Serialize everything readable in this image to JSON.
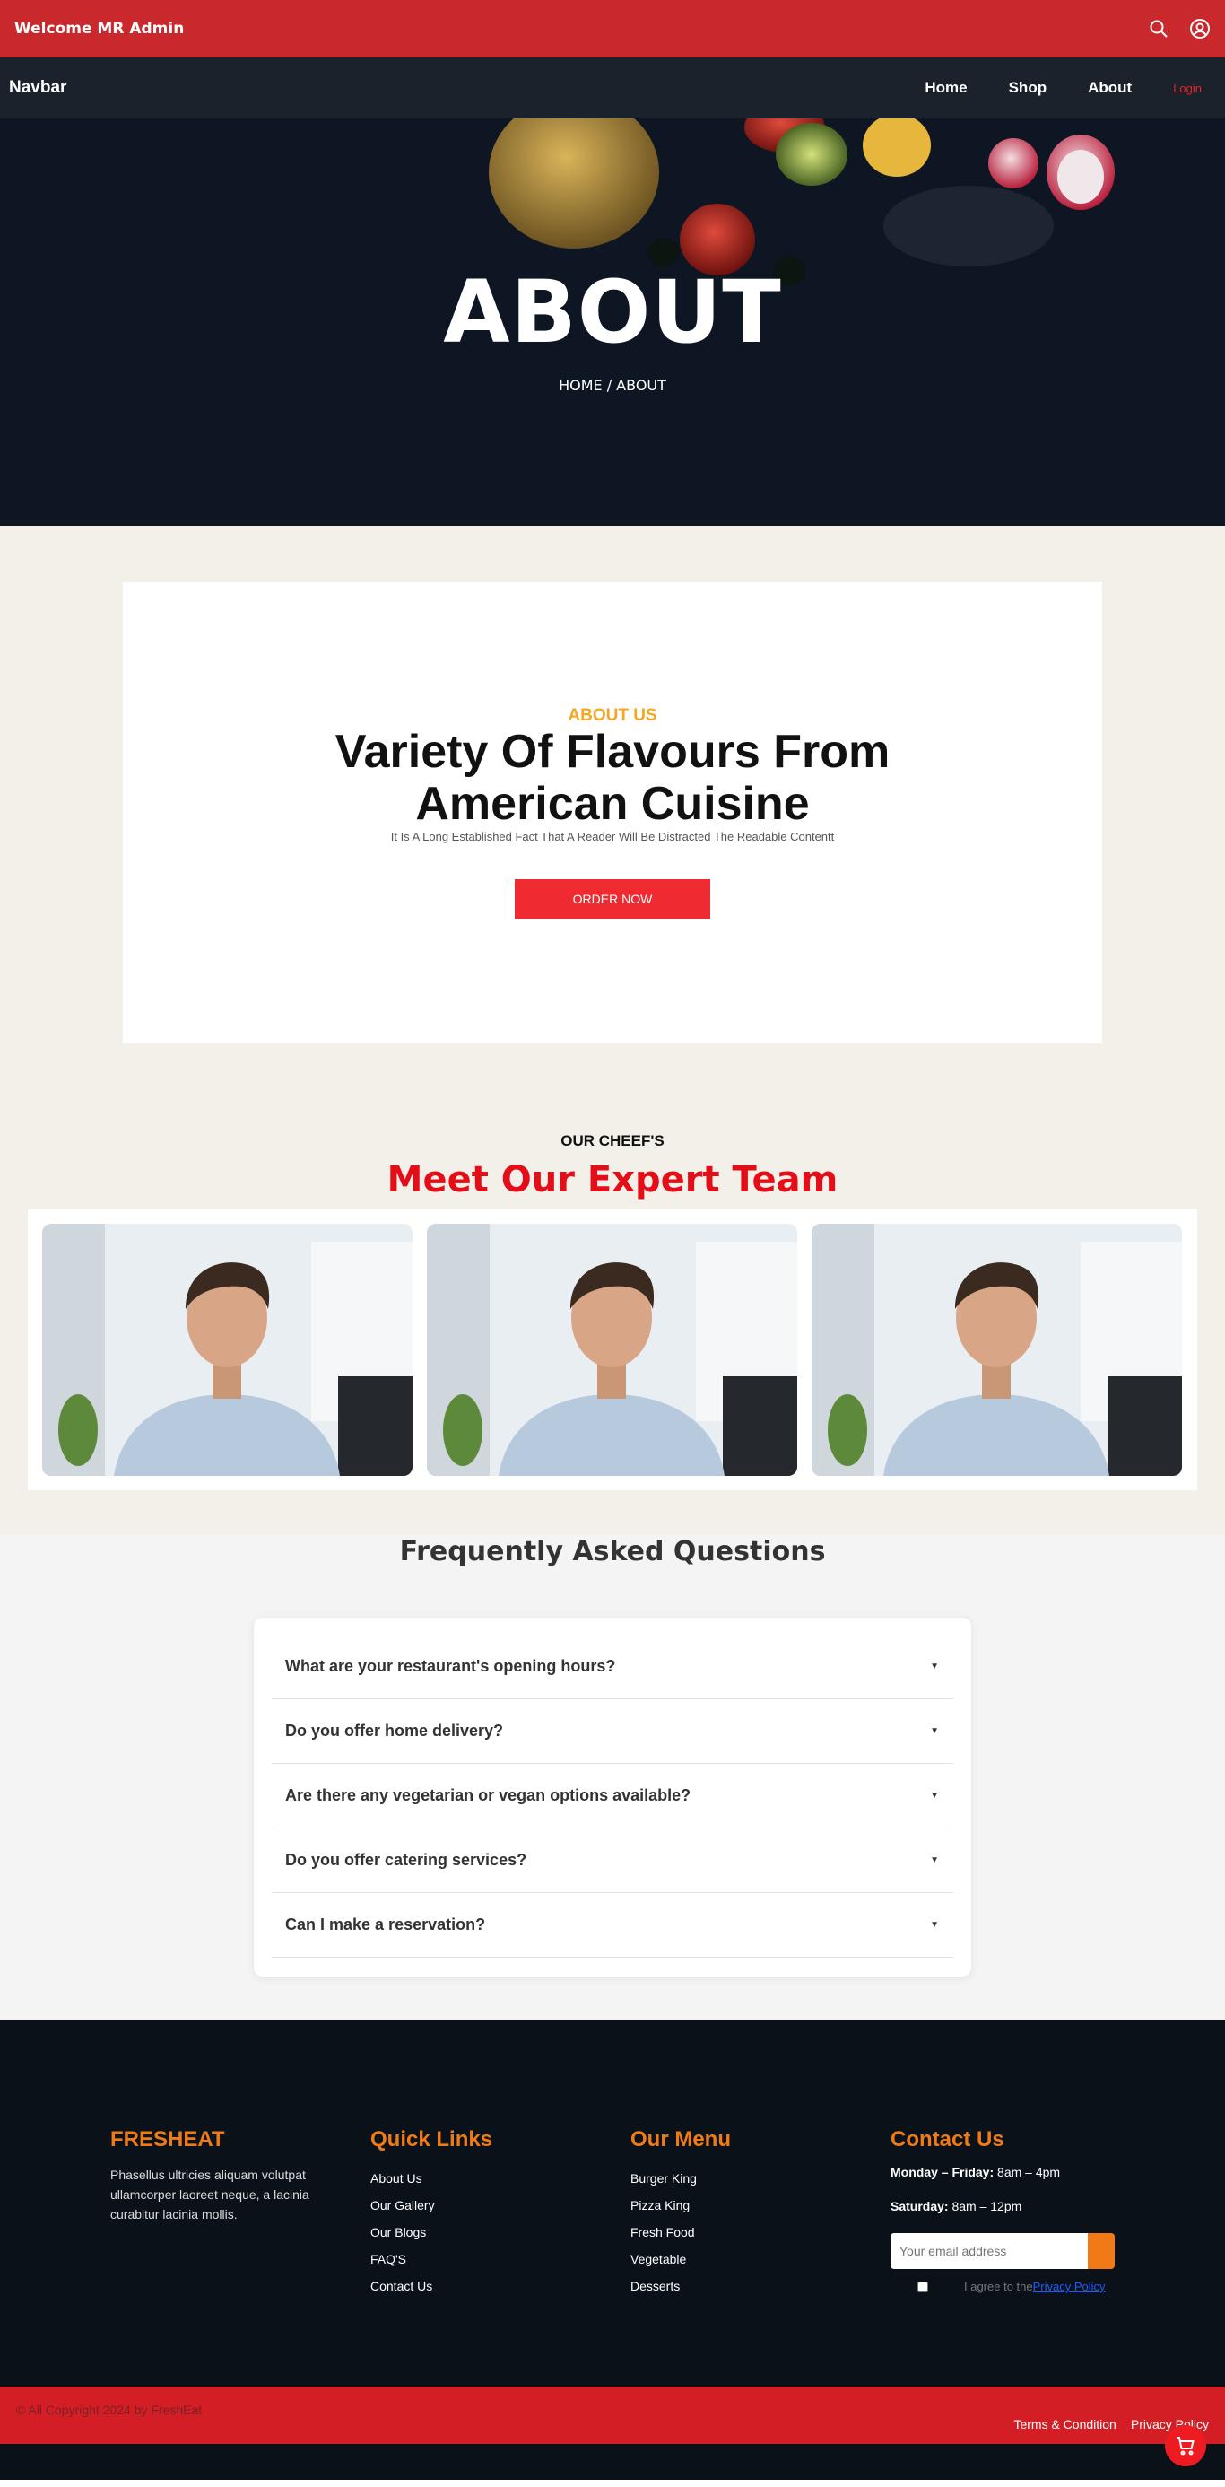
{
  "topbar": {
    "welcome": "Welcome MR Admin",
    "search_icon": "search-icon",
    "account_icon": "user-circle-icon"
  },
  "navbar": {
    "brand": "Navbar",
    "links": [
      "Home",
      "Shop",
      "About"
    ],
    "login": "Login"
  },
  "hero": {
    "title": "ABOUT",
    "breadcrumb": "HOME / ABOUT"
  },
  "about": {
    "eyebrow": "ABOUT US",
    "heading_line1": "Variety Of Flavours From",
    "heading_line2": "American Cuisine",
    "subtext": "It Is A Long Established Fact That A Reader Will Be Distracted The Readable Contentt",
    "button": "ORDER NOW"
  },
  "team": {
    "eyebrow": "OUR CHEEF'S",
    "title": "Meet Our Expert Team",
    "members": 3
  },
  "faq": {
    "title": "Frequently Asked Questions",
    "items": [
      "What are your restaurant's opening hours?",
      "Do you offer home delivery?",
      "Are there any vegetarian or vegan options available?",
      "Do you offer catering services?",
      "Can I make a reservation?"
    ]
  },
  "footer": {
    "brand": {
      "title": "FRESHEAT",
      "text": "Phasellus ultricies aliquam volutpat ullamcorper laoreet neque, a lacinia curabitur lacinia mollis."
    },
    "quick_links": {
      "title": "Quick Links",
      "items": [
        "About Us",
        "Our Gallery",
        "Our Blogs",
        "FAQ'S",
        "Contact Us"
      ]
    },
    "menu": {
      "title": "Our Menu",
      "items": [
        "Burger King",
        "Pizza King",
        "Fresh Food",
        "Vegetable",
        "Desserts"
      ]
    },
    "contact": {
      "title": "Contact Us",
      "weekday_label": "Monday – Friday:",
      "weekday_hours": "8am – 4pm",
      "saturday_label": "Saturday:",
      "saturday_hours": "8am – 12pm",
      "email_placeholder": "Your email address",
      "agree_text": "I agree to the",
      "policy_link": "Privacy Policy"
    }
  },
  "bottombar": {
    "copyright": "© All Copyright 2024 by FreshEat",
    "terms": "Terms & Condition",
    "privacy": "Privacy Policy"
  },
  "colors": {
    "topbar": "#c9282d",
    "navbar": "#1b222c",
    "accent_orange": "#f07b16",
    "accent_red": "#e40e19"
  }
}
